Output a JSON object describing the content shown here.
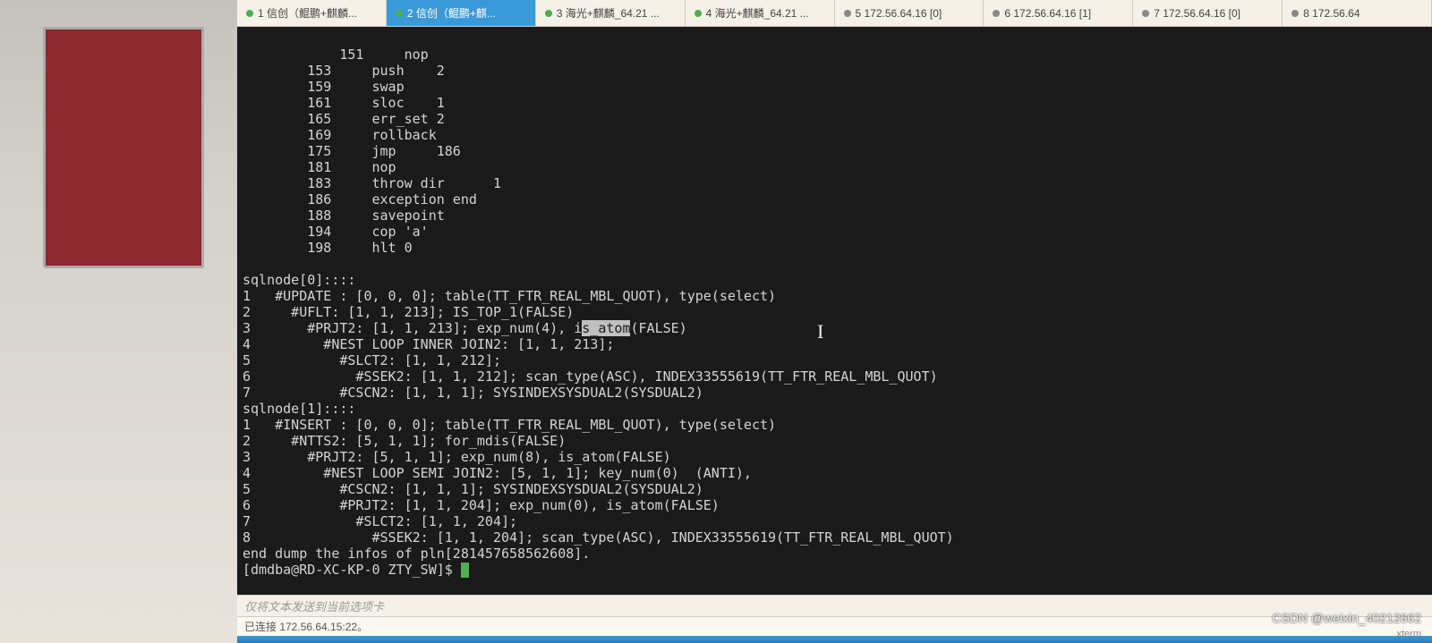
{
  "tabs": [
    {
      "icon": "green",
      "label": "1 信创（鲲鹏+麒麟..."
    },
    {
      "icon": "green",
      "label": "2 信创（鲲鹏+麒...",
      "active": true
    },
    {
      "icon": "green",
      "label": "3 海光+麒麟_64.21 ..."
    },
    {
      "icon": "green",
      "label": "4 海光+麒麟_64.21 ..."
    },
    {
      "icon": "gray",
      "label": "5 172.56.64.16 [0]"
    },
    {
      "icon": "gray",
      "label": "6 172.56.64.16 [1]"
    },
    {
      "icon": "gray",
      "label": "7 172.56.64.16 [0]"
    },
    {
      "icon": "gray",
      "label": "8 172.56.64"
    }
  ],
  "term_lines_top": [
    "        151     nop",
    "        153     push    2",
    "        159     swap",
    "        161     sloc    1",
    "        165     err_set 2",
    "        169     rollback",
    "        175     jmp     186",
    "        181     nop",
    "        183     throw dir      1",
    "        186     exception end",
    "        188     savepoint",
    "        194     cop 'a'",
    "        198     hlt 0",
    ""
  ],
  "term_sqlnode0_header": "sqlnode[0]::::",
  "term_sqlnode0_lines": [
    "1   #UPDATE : [0, 0, 0]; table(TT_FTR_REAL_MBL_QUOT), type(select)",
    "2     #UFLT: [1, 1, 213]; IS_TOP_1(FALSE)"
  ],
  "term_hl_pre": "3       #PRJT2: [1, 1, 213]; exp_num(4), i",
  "term_hl_mid": "s_atom",
  "term_hl_post": "(FALSE)",
  "term_sqlnode0_rest": [
    "4         #NEST LOOP INNER JOIN2: [1, 1, 213];",
    "5           #SLCT2: [1, 1, 212];",
    "6             #SSEK2: [1, 1, 212]; scan_type(ASC), INDEX33555619(TT_FTR_REAL_MBL_QUOT)",
    "7           #CSCN2: [1, 1, 1]; SYSINDEXSYSDUAL2(SYSDUAL2)"
  ],
  "term_sqlnode1_header": "sqlnode[1]::::",
  "term_sqlnode1_lines": [
    "1   #INSERT : [0, 0, 0]; table(TT_FTR_REAL_MBL_QUOT), type(select)",
    "2     #NTTS2: [5, 1, 1]; for_mdis(FALSE)",
    "3       #PRJT2: [5, 1, 1]; exp_num(8), is_atom(FALSE)",
    "4         #NEST LOOP SEMI JOIN2: [5, 1, 1]; key_num(0)  (ANTI),",
    "5           #CSCN2: [1, 1, 1]; SYSINDEXSYSDUAL2(SYSDUAL2)",
    "6           #PRJT2: [1, 1, 204]; exp_num(0), is_atom(FALSE)",
    "7             #SLCT2: [1, 1, 204];",
    "8               #SSEK2: [1, 1, 204]; scan_type(ASC), INDEX33555619(TT_FTR_REAL_MBL_QUOT)"
  ],
  "term_footer": "end dump the infos of pln[281457658562608].",
  "term_prompt": "[dmdba@RD-XC-KP-0 ZTY_SW]$ ",
  "input_placeholder": "仅将文本发送到当前选项卡",
  "status_text": "已连接 172.56.64.15:22。",
  "watermark": "CSDN @weixin_40212662",
  "xterm_label": "xterm"
}
